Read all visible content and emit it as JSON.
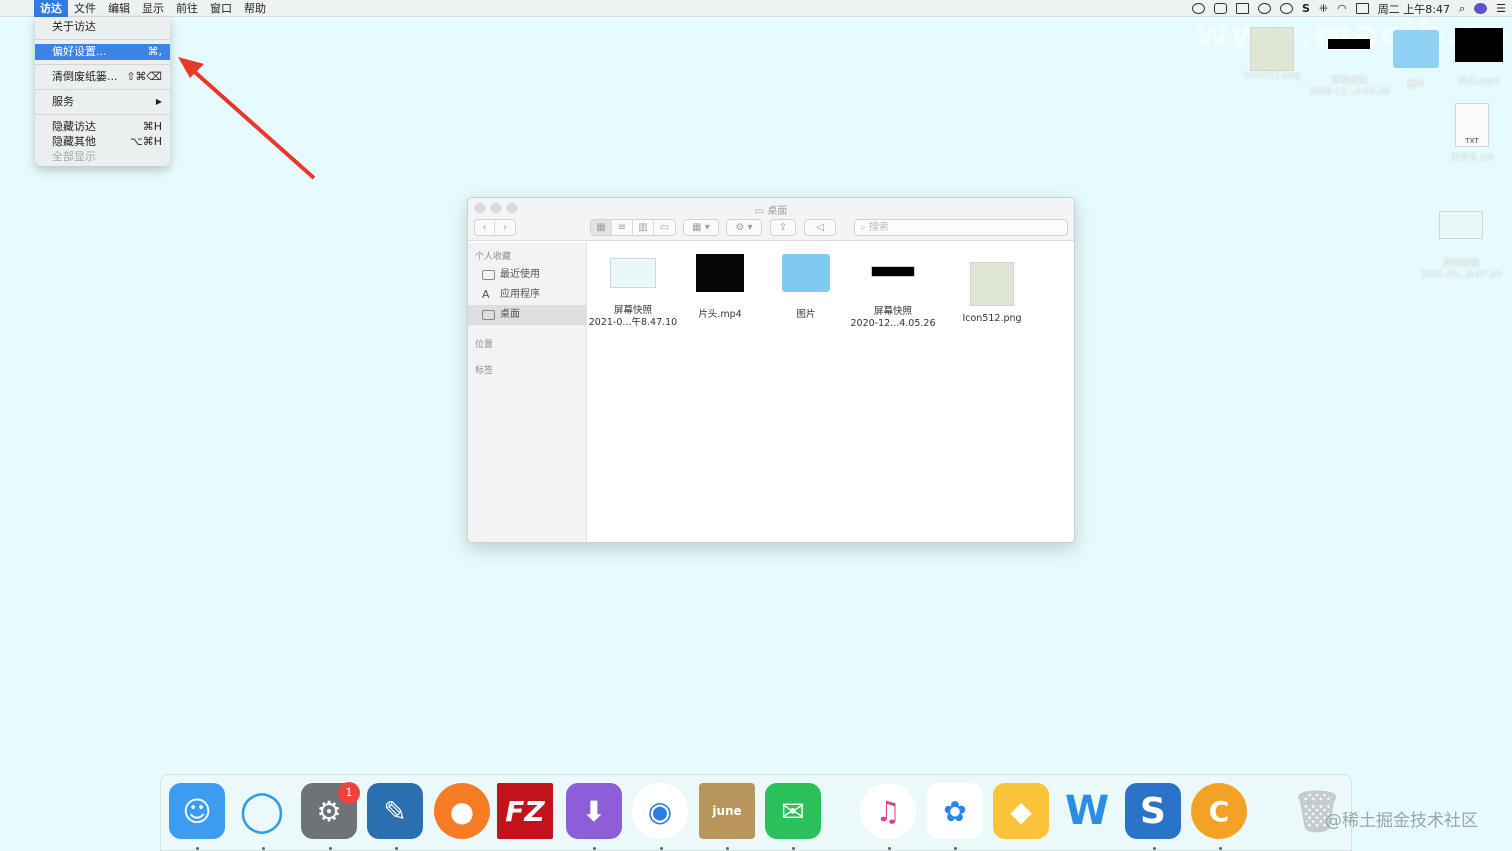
{
  "menubar": {
    "apple": "",
    "items": [
      "访达",
      "文件",
      "编辑",
      "显示",
      "前往",
      "窗口",
      "帮助"
    ],
    "clock": "周二 上午8:47"
  },
  "dropdown": {
    "about": "关于访达",
    "prefs": "偏好设置...",
    "prefs_shortcut": "⌘,",
    "empty_trash": "清倒废纸篓...",
    "empty_trash_shortcut": "⇧⌘⌫",
    "services": "服务",
    "services_arrow": "▶",
    "hide": "隐藏访达",
    "hide_shortcut": "⌘H",
    "hide_others": "隐藏其他",
    "hide_others_shortcut": "⌥⌘H",
    "show_all": "全部显示"
  },
  "desktop": {
    "watermark": "www.macjb.com",
    "icons": [
      {
        "label": "Icon512.png"
      },
      {
        "label": "屏幕快照",
        "sub": "2020-12...4.05.26"
      },
      {
        "label": "图片"
      },
      {
        "label": "片头.mp4"
      },
      {
        "label": "未命名.txt"
      },
      {
        "label": "屏幕快照",
        "sub": "2021-09...8.47.10"
      }
    ]
  },
  "finder": {
    "title": "桌面",
    "search_placeholder": "搜索",
    "sidebar": {
      "favorites_header": "个人收藏",
      "recents": "最近使用",
      "apps": "应用程序",
      "desktop": "桌面",
      "locations_header": "位置",
      "tags_header": "标签"
    },
    "files": [
      {
        "name": "屏幕快照",
        "sub": "2021-0...午8.47.10"
      },
      {
        "name": "片头.mp4",
        "sub": ""
      },
      {
        "name": "图片",
        "sub": ""
      },
      {
        "name": "屏幕快照",
        "sub": "2020-12...4.05.26"
      },
      {
        "name": "Icon512.png",
        "sub": ""
      }
    ]
  },
  "dock": {
    "badge": "1",
    "apps": [
      "Finder",
      "QQ",
      "系统偏好设置",
      "Xcode-tool",
      "Firefox",
      "FileZilla",
      "Downie",
      "Chrome",
      "Notebook",
      "微信",
      "iTunes",
      "百度网盘",
      "Sketch",
      "WPS",
      "Sublime",
      "Chrome-like",
      "废纸篓"
    ]
  },
  "credit": "@稀土掘金技术社区"
}
